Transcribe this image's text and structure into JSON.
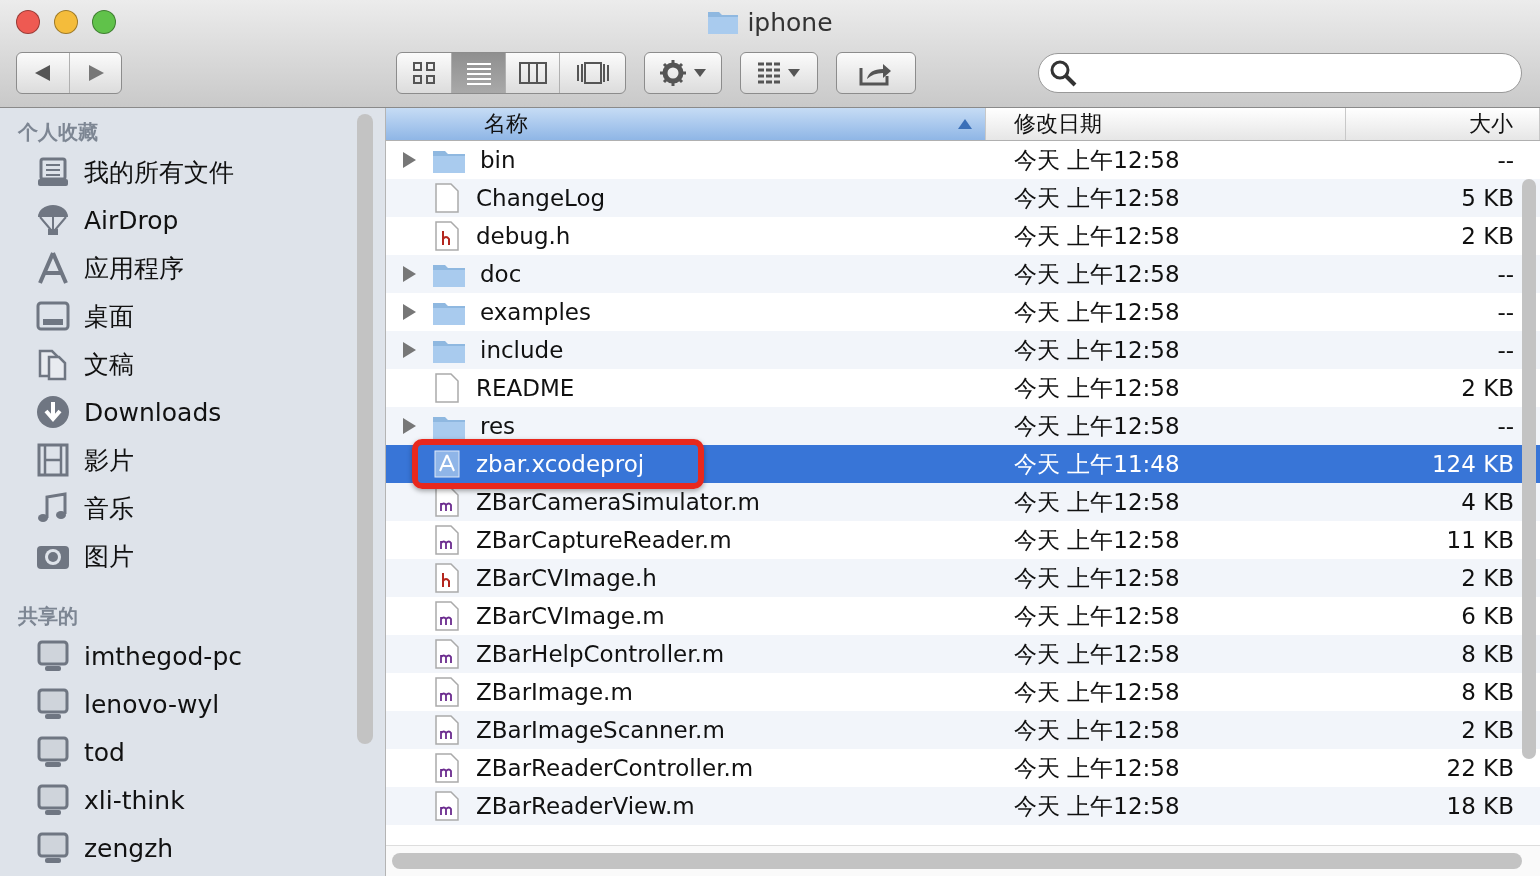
{
  "window": {
    "title": "iphone"
  },
  "toolbar": {
    "views": [
      {
        "kind": "icons",
        "selected": false
      },
      {
        "kind": "list",
        "selected": true
      },
      {
        "kind": "columns",
        "selected": false
      },
      {
        "kind": "coverflow",
        "selected": false
      }
    ]
  },
  "sidebar": {
    "sections": [
      {
        "title": "个人收藏",
        "items": [
          {
            "label": "我的所有文件"
          },
          {
            "label": "AirDrop"
          },
          {
            "label": "应用程序"
          },
          {
            "label": "桌面"
          },
          {
            "label": "文稿"
          },
          {
            "label": "Downloads"
          },
          {
            "label": "影片"
          },
          {
            "label": "音乐"
          },
          {
            "label": "图片"
          }
        ]
      },
      {
        "title": "共享的",
        "items": [
          {
            "label": "imthegod-pc"
          },
          {
            "label": "lenovo-wyl"
          },
          {
            "label": "tod"
          },
          {
            "label": "xli-think"
          },
          {
            "label": "zengzh"
          }
        ]
      }
    ]
  },
  "table": {
    "columns": [
      {
        "label": "名称",
        "sorted": true
      },
      {
        "label": "修改日期",
        "sorted": false
      },
      {
        "label": "大小",
        "sorted": false
      }
    ],
    "rows": [
      {
        "name": "bin",
        "kind": "folder",
        "date": "今天 上午12:58",
        "size": "--",
        "selected": false,
        "annotated": false
      },
      {
        "name": "ChangeLog",
        "kind": "document",
        "date": "今天 上午12:58",
        "size": "5 KB",
        "selected": false,
        "annotated": false
      },
      {
        "name": "debug.h",
        "kind": "header",
        "date": "今天 上午12:58",
        "size": "2 KB",
        "selected": false,
        "annotated": false
      },
      {
        "name": "doc",
        "kind": "folder",
        "date": "今天 上午12:58",
        "size": "--",
        "selected": false,
        "annotated": false
      },
      {
        "name": "examples",
        "kind": "folder",
        "date": "今天 上午12:58",
        "size": "--",
        "selected": false,
        "annotated": false
      },
      {
        "name": "include",
        "kind": "folder",
        "date": "今天 上午12:58",
        "size": "--",
        "selected": false,
        "annotated": false
      },
      {
        "name": "README",
        "kind": "document",
        "date": "今天 上午12:58",
        "size": "2 KB",
        "selected": false,
        "annotated": false
      },
      {
        "name": "res",
        "kind": "folder",
        "date": "今天 上午12:58",
        "size": "--",
        "selected": false,
        "annotated": false
      },
      {
        "name": "zbar.xcodeproj",
        "kind": "project",
        "date": "今天 上午11:48",
        "size": "124 KB",
        "selected": true,
        "annotated": true
      },
      {
        "name": "ZBarCameraSimulator.m",
        "kind": "source",
        "date": "今天 上午12:58",
        "size": "4 KB",
        "selected": false,
        "annotated": false
      },
      {
        "name": "ZBarCaptureReader.m",
        "kind": "source",
        "date": "今天 上午12:58",
        "size": "11 KB",
        "selected": false,
        "annotated": false
      },
      {
        "name": "ZBarCVImage.h",
        "kind": "header",
        "date": "今天 上午12:58",
        "size": "2 KB",
        "selected": false,
        "annotated": false
      },
      {
        "name": "ZBarCVImage.m",
        "kind": "source",
        "date": "今天 上午12:58",
        "size": "6 KB",
        "selected": false,
        "annotated": false
      },
      {
        "name": "ZBarHelpController.m",
        "kind": "source",
        "date": "今天 上午12:58",
        "size": "8 KB",
        "selected": false,
        "annotated": false
      },
      {
        "name": "ZBarImage.m",
        "kind": "source",
        "date": "今天 上午12:58",
        "size": "8 KB",
        "selected": false,
        "annotated": false
      },
      {
        "name": "ZBarImageScanner.m",
        "kind": "source",
        "date": "今天 上午12:58",
        "size": "2 KB",
        "selected": false,
        "annotated": false
      },
      {
        "name": "ZBarReaderController.m",
        "kind": "source",
        "date": "今天 上午12:58",
        "size": "22 KB",
        "selected": false,
        "annotated": false
      },
      {
        "name": "ZBarReaderView.m",
        "kind": "source",
        "date": "今天 上午12:58",
        "size": "18 KB",
        "selected": false,
        "annotated": false
      }
    ]
  }
}
